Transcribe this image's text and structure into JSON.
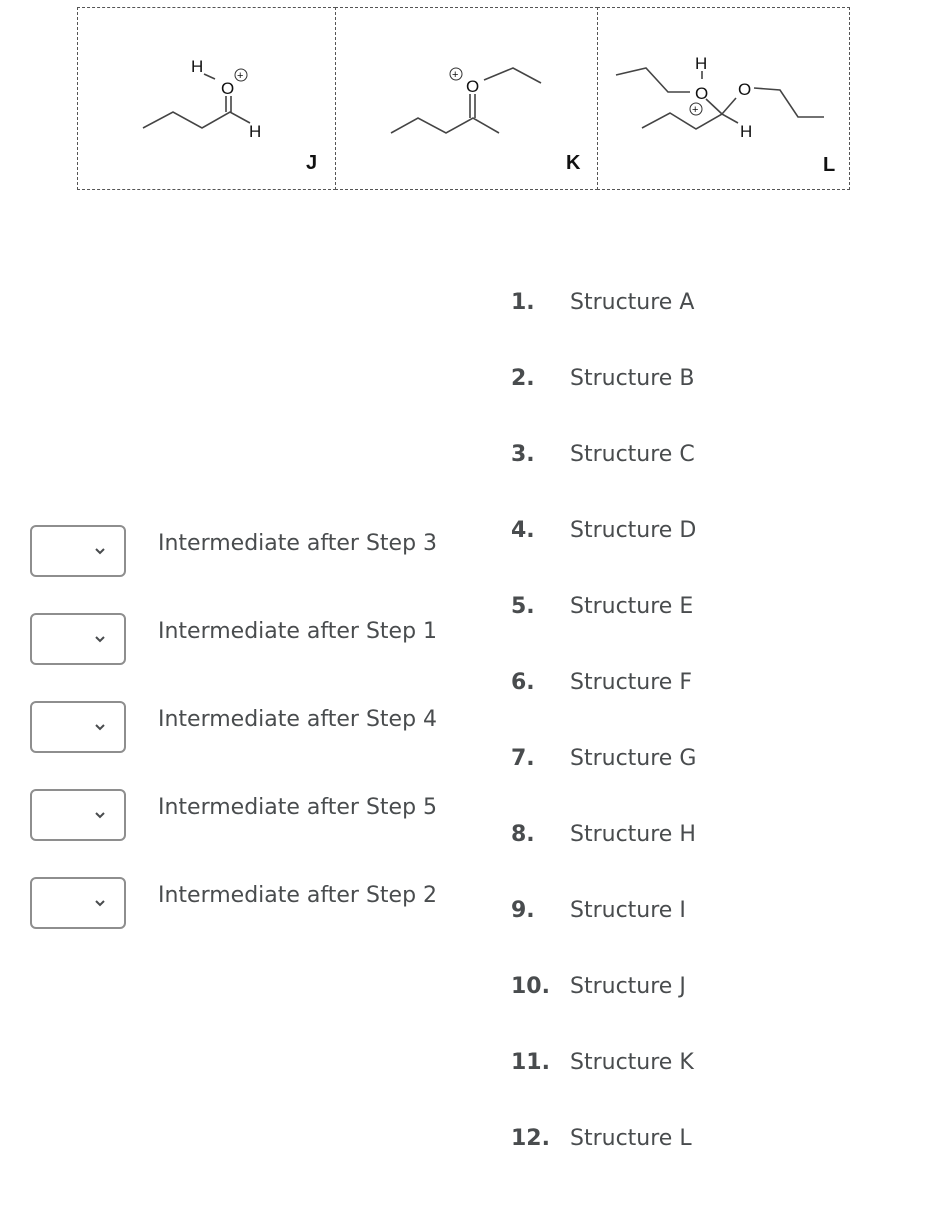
{
  "structures": [
    {
      "label": "J",
      "name": "protonated butanal (oxocarbenium)"
    },
    {
      "label": "K",
      "name": "O-ethyl oxonium of 2-pentanone"
    },
    {
      "label": "L",
      "name": "protonated hemiacetal-ether"
    }
  ],
  "atoms": {
    "H": "H",
    "O": "O",
    "plus": "+"
  },
  "matching": {
    "rows": [
      {
        "label": "Intermediate after Step 3",
        "selected": ""
      },
      {
        "label": "Intermediate after Step 1",
        "selected": ""
      },
      {
        "label": "Intermediate after Step 4",
        "selected": ""
      },
      {
        "label": "Intermediate after Step 5",
        "selected": ""
      },
      {
        "label": "Intermediate after Step 2",
        "selected": ""
      }
    ],
    "options": [
      {
        "num": "1.",
        "text": "Structure A"
      },
      {
        "num": "2.",
        "text": "Structure B"
      },
      {
        "num": "3.",
        "text": "Structure C"
      },
      {
        "num": "4.",
        "text": "Structure D"
      },
      {
        "num": "5.",
        "text": "Structure E"
      },
      {
        "num": "6.",
        "text": "Structure F"
      },
      {
        "num": "7.",
        "text": "Structure G"
      },
      {
        "num": "8.",
        "text": "Structure H"
      },
      {
        "num": "9.",
        "text": "Structure I"
      },
      {
        "num": "10.",
        "text": "Structure J"
      },
      {
        "num": "11.",
        "text": "Structure K"
      },
      {
        "num": "12.",
        "text": "Structure L"
      }
    ]
  }
}
